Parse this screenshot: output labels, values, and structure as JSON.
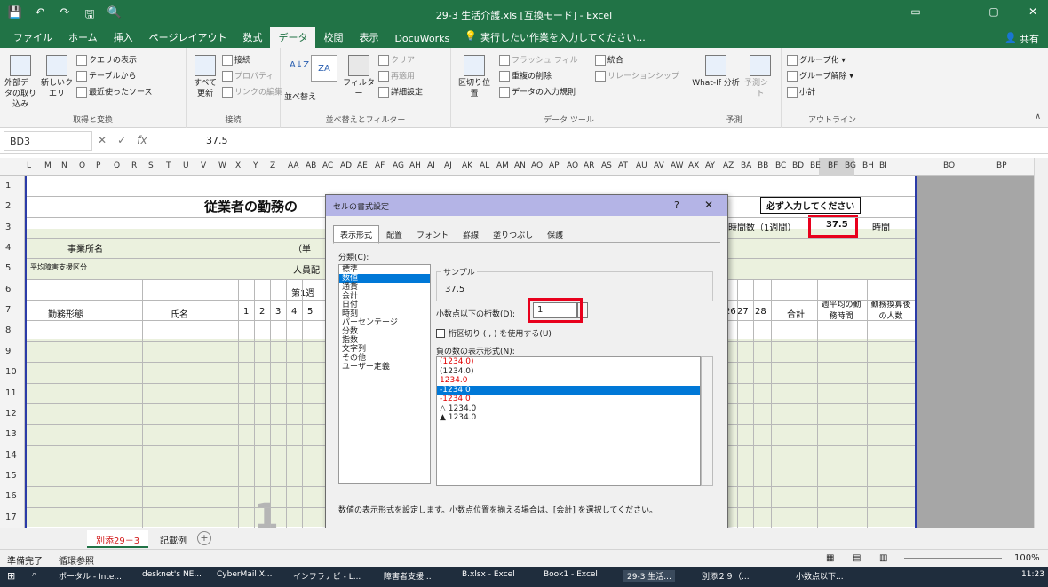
{
  "window": {
    "title": "29-3 生活介護.xls [互換モード] - Excel",
    "qat": [
      "💾",
      "↶",
      "↷",
      "🖫",
      "🔍"
    ],
    "controls": [
      "▭",
      "—",
      "▢",
      "✕"
    ]
  },
  "ribbon_tabs": [
    "ファイル",
    "ホーム",
    "挿入",
    "ページレイアウト",
    "数式",
    "データ",
    "校閲",
    "表示",
    "DocuWorks"
  ],
  "active_tab": "データ",
  "tell_me": "実行したい作業を入力してください...",
  "share": "共有",
  "ribbon": {
    "groups": [
      {
        "label": "取得と変換",
        "buttons": [
          "外部データの取り込み",
          "新しいクエリ",
          "クエリの表示",
          "テーブルから",
          "最近使ったソース"
        ]
      },
      {
        "label": "接続",
        "buttons": [
          "すべて更新",
          "接続",
          "プロパティ",
          "リンクの編集"
        ]
      },
      {
        "label": "並べ替えとフィルター",
        "buttons": [
          "並べ替え",
          "フィルター",
          "クリア",
          "再適用",
          "詳細設定"
        ]
      },
      {
        "label": "データ ツール",
        "buttons": [
          "区切り位置",
          "フラッシュ フィル",
          "重複の削除",
          "データの入力規則",
          "統合",
          "リレーションシップ"
        ]
      },
      {
        "label": "予測",
        "buttons": [
          "What-If 分析",
          "予測シート"
        ]
      },
      {
        "label": "アウトライン",
        "buttons": [
          "グループ化",
          "グループ解除",
          "小計"
        ]
      }
    ]
  },
  "formula_bar": {
    "name_box": "BD3",
    "value": "37.5",
    "icons": [
      "✕",
      "✓",
      "fx"
    ]
  },
  "columns": [
    "L",
    "M",
    "N",
    "O",
    "P",
    "Q",
    "R",
    "S",
    "T",
    "U",
    "V",
    "W",
    "X",
    "Y",
    "Z",
    "AA",
    "AB",
    "AC",
    "AD",
    "AE",
    "AF",
    "AG",
    "AH",
    "AI",
    "AJ",
    "AK",
    "AL",
    "AM",
    "AN",
    "AO",
    "AP",
    "AQ",
    "AR",
    "AS",
    "AT",
    "AU",
    "AV",
    "AW",
    "AX",
    "AY",
    "AZ",
    "BA",
    "BB",
    "BC",
    "BD",
    "BE",
    "BF",
    "BG",
    "BH",
    "BI",
    "BO",
    "BP"
  ],
  "rows": [
    "1",
    "2",
    "3",
    "4",
    "5",
    "6",
    "7",
    "8",
    "9",
    "10",
    "11",
    "12",
    "13",
    "14",
    "15",
    "16",
    "17"
  ],
  "sheet": {
    "title": "従業者の勤務の",
    "must_input": "必ず入力してください",
    "hours_label": "時間数（1週間）",
    "hours_value": "37.5",
    "hours_unit": "時間",
    "office_name": "事業所名",
    "avg_support": "平均障害支援区分",
    "personnel": "人員配",
    "kanji_paren": "（単",
    "week1": "第1週",
    "work_type": "勤務形態",
    "name": "氏名",
    "days": [
      "1",
      "2",
      "3",
      "4",
      "5"
    ],
    "days_end": [
      "26",
      "27",
      "28"
    ],
    "total": "合計",
    "weekly_avg": "週平均の勤務時間",
    "converted": "勤務換算後の人数",
    "watermark": "1"
  },
  "dialog": {
    "title": "セルの書式設定",
    "help": "?",
    "close": "✕",
    "tabs": [
      "表示形式",
      "配置",
      "フォント",
      "罫線",
      "塗りつぶし",
      "保護"
    ],
    "active_tab": "表示形式",
    "category_label": "分類(C):",
    "categories": [
      "標準",
      "数値",
      "通貨",
      "会計",
      "日付",
      "時刻",
      "パーセンテージ",
      "分数",
      "指数",
      "文字列",
      "その他",
      "ユーザー定義"
    ],
    "selected_category": "数値",
    "sample_label": "サンプル",
    "sample_value": "37.5",
    "decimal_label": "小数点以下の桁数(D):",
    "decimal_value": "1",
    "separator_label": "桁区切り ( , ) を使用する(U)",
    "negative_label": "負の数の表示形式(N):",
    "negative_formats": [
      {
        "text": "(1234.0)",
        "red": true
      },
      {
        "text": "(1234.0)",
        "red": false
      },
      {
        "text": "1234.0",
        "red": true
      },
      {
        "text": "-1234.0",
        "red": false,
        "selected": true
      },
      {
        "text": "-1234.0",
        "red": true
      },
      {
        "text": "△ 1234.0",
        "red": false
      },
      {
        "text": "▲ 1234.0",
        "red": false
      }
    ],
    "help_text": "数値の表示形式を設定します。小数点位置を揃える場合は、[会計] を選択してください。"
  },
  "sheet_tabs": [
    "別添29－3",
    "記載例"
  ],
  "active_sheet": "別添29－3",
  "add_sheet": "+",
  "status": {
    "ready": "準備完了",
    "accessibility": "循環参照",
    "zoom": "100%"
  },
  "taskbar": {
    "items": [
      "ポータル - Inte...",
      "desknet's NE...",
      "CyberMail X...",
      "インフラナビ - L...",
      "障害者支援...",
      "B.xlsx - Excel",
      "Book1 - Excel",
      "29-3 生活...",
      "別添２９（...",
      "小数点以下..."
    ],
    "active": "29-3 生活...",
    "time": "11:23"
  },
  "colors": {
    "excel_green": "#217346",
    "dialog_title": "#b4b4e6",
    "highlight_red": "#e8001c",
    "row_green": "#ebf1de",
    "selection_blue": "#0078d7"
  }
}
